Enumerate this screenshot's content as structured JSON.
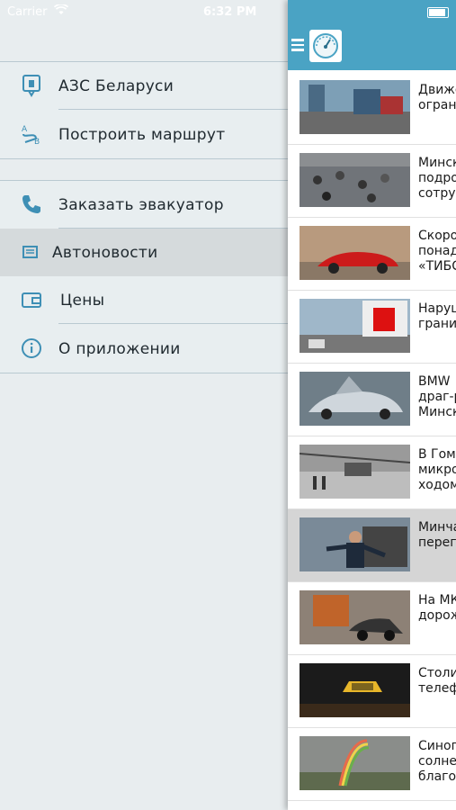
{
  "status_bar": {
    "carrier": "Carrier",
    "time": "6:32 PM"
  },
  "menu": {
    "group1": [
      {
        "label": "АЗС Беларуси",
        "icon": "gas-station-pin-icon"
      },
      {
        "label": "Построить маршрут",
        "icon": "route-icon"
      }
    ],
    "group2": [
      {
        "label": "Заказать эвакуатор",
        "icon": "phone-icon"
      },
      {
        "label": "Автоновости",
        "icon": "newspaper-icon",
        "active": true
      },
      {
        "label": "Цены",
        "icon": "wallet-icon"
      },
      {
        "label": "О приложении",
        "icon": "info-icon"
      }
    ]
  },
  "news_panel": {
    "accent_color": "#4aa3c4",
    "items": [
      {
        "title": "Движе\nогран"
      },
      {
        "title": "Минск\nподро\nсотру"
      },
      {
        "title": "Скоро\nпонад\n«ТИБС"
      },
      {
        "title": "Наруш\nграни"
      },
      {
        "title": "BMW\nдраг-р\nМинск"
      },
      {
        "title": "В Гом\nмикро\nходом"
      },
      {
        "title": "Минча\nперег"
      },
      {
        "title": "На МК\nдорож"
      },
      {
        "title": "Столи\nтелеф"
      },
      {
        "title": "Синоп\nсолне\nблаго"
      }
    ]
  }
}
